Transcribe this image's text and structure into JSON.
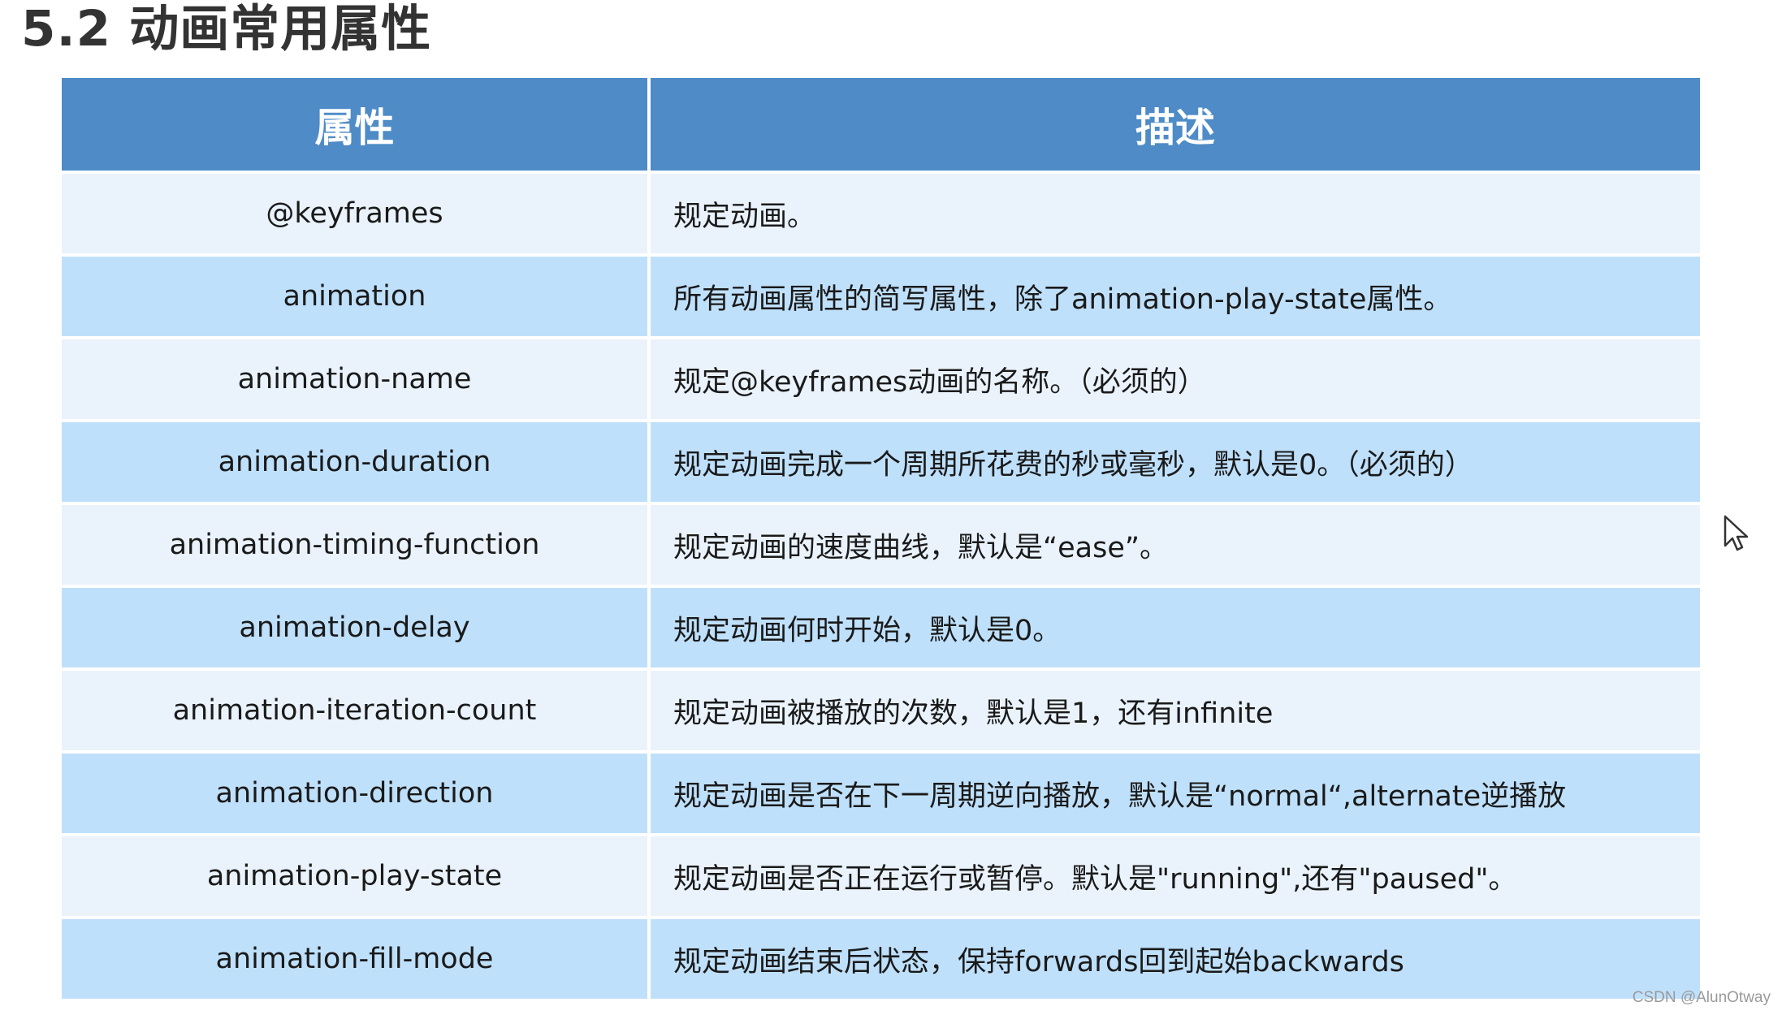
{
  "title": "5.2 动画常用属性",
  "table": {
    "headers": {
      "property": "属性",
      "description": "描述"
    },
    "rows": [
      {
        "property": "@keyframes",
        "description": "规定动画。"
      },
      {
        "property": "animation",
        "description": "所有动画属性的简写属性，除了animation-play-state属性。"
      },
      {
        "property": "animation-name",
        "description": "规定@keyframes动画的名称。（必须的）"
      },
      {
        "property": "animation-duration",
        "description": "规定动画完成一个周期所花费的秒或毫秒，默认是0。（必须的）"
      },
      {
        "property": "animation-timing-function",
        "description": "规定动画的速度曲线，默认是“ease”。"
      },
      {
        "property": "animation-delay",
        "description": "规定动画何时开始，默认是0。"
      },
      {
        "property": "animation-iteration-count",
        "description": "规定动画被播放的次数，默认是1，还有infinite"
      },
      {
        "property": "animation-direction",
        "description": "规定动画是否在下一周期逆向播放，默认是“normal“,alternate逆播放"
      },
      {
        "property": "animation-play-state",
        "description": "规定动画是否正在运行或暂停。默认是\"running\",还有\"paused\"。"
      },
      {
        "property": "animation-fill-mode",
        "description": "规定动画结束后状态，保持forwards回到起始backwards"
      }
    ]
  },
  "watermark": "CSDN @AlunOtway",
  "cursor_icon": "mouse-pointer-icon",
  "colors": {
    "header_bg": "#4e8bc7",
    "row_light": "#eaf3fc",
    "row_dark": "#bfe0fb"
  }
}
